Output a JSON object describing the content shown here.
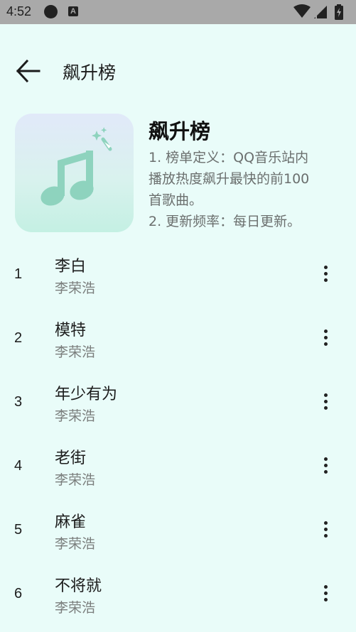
{
  "status_bar": {
    "time": "4:52",
    "notification_icon": "circle-notification-icon",
    "app_icon_letter": "A",
    "icons": [
      "wifi-icon",
      "signal-icon",
      "battery-icon"
    ]
  },
  "app_bar": {
    "back_icon": "arrow-left-icon",
    "title": "飙升榜"
  },
  "playlist": {
    "cover_icon": "music-note-icon",
    "title": "飙升榜",
    "description_lines": [
      "1. 榜单定义：QQ音乐站内",
      "播放热度飙升最快的前100",
      "首歌曲。",
      "2. 更新频率：每日更新。"
    ]
  },
  "songs": [
    {
      "rank": "1",
      "name": "李白",
      "artist": "李荣浩"
    },
    {
      "rank": "2",
      "name": "模特",
      "artist": "李荣浩"
    },
    {
      "rank": "3",
      "name": "年少有为",
      "artist": "李荣浩"
    },
    {
      "rank": "4",
      "name": "老街",
      "artist": "李荣浩"
    },
    {
      "rank": "5",
      "name": "麻雀",
      "artist": "李荣浩"
    },
    {
      "rank": "6",
      "name": "不将就",
      "artist": "李荣浩"
    }
  ],
  "colors": {
    "background": "#e9fcf9",
    "status_bar": "#a9a9a9",
    "cover_note": "#8ed3be",
    "secondary_text": "#7a7d7c"
  }
}
